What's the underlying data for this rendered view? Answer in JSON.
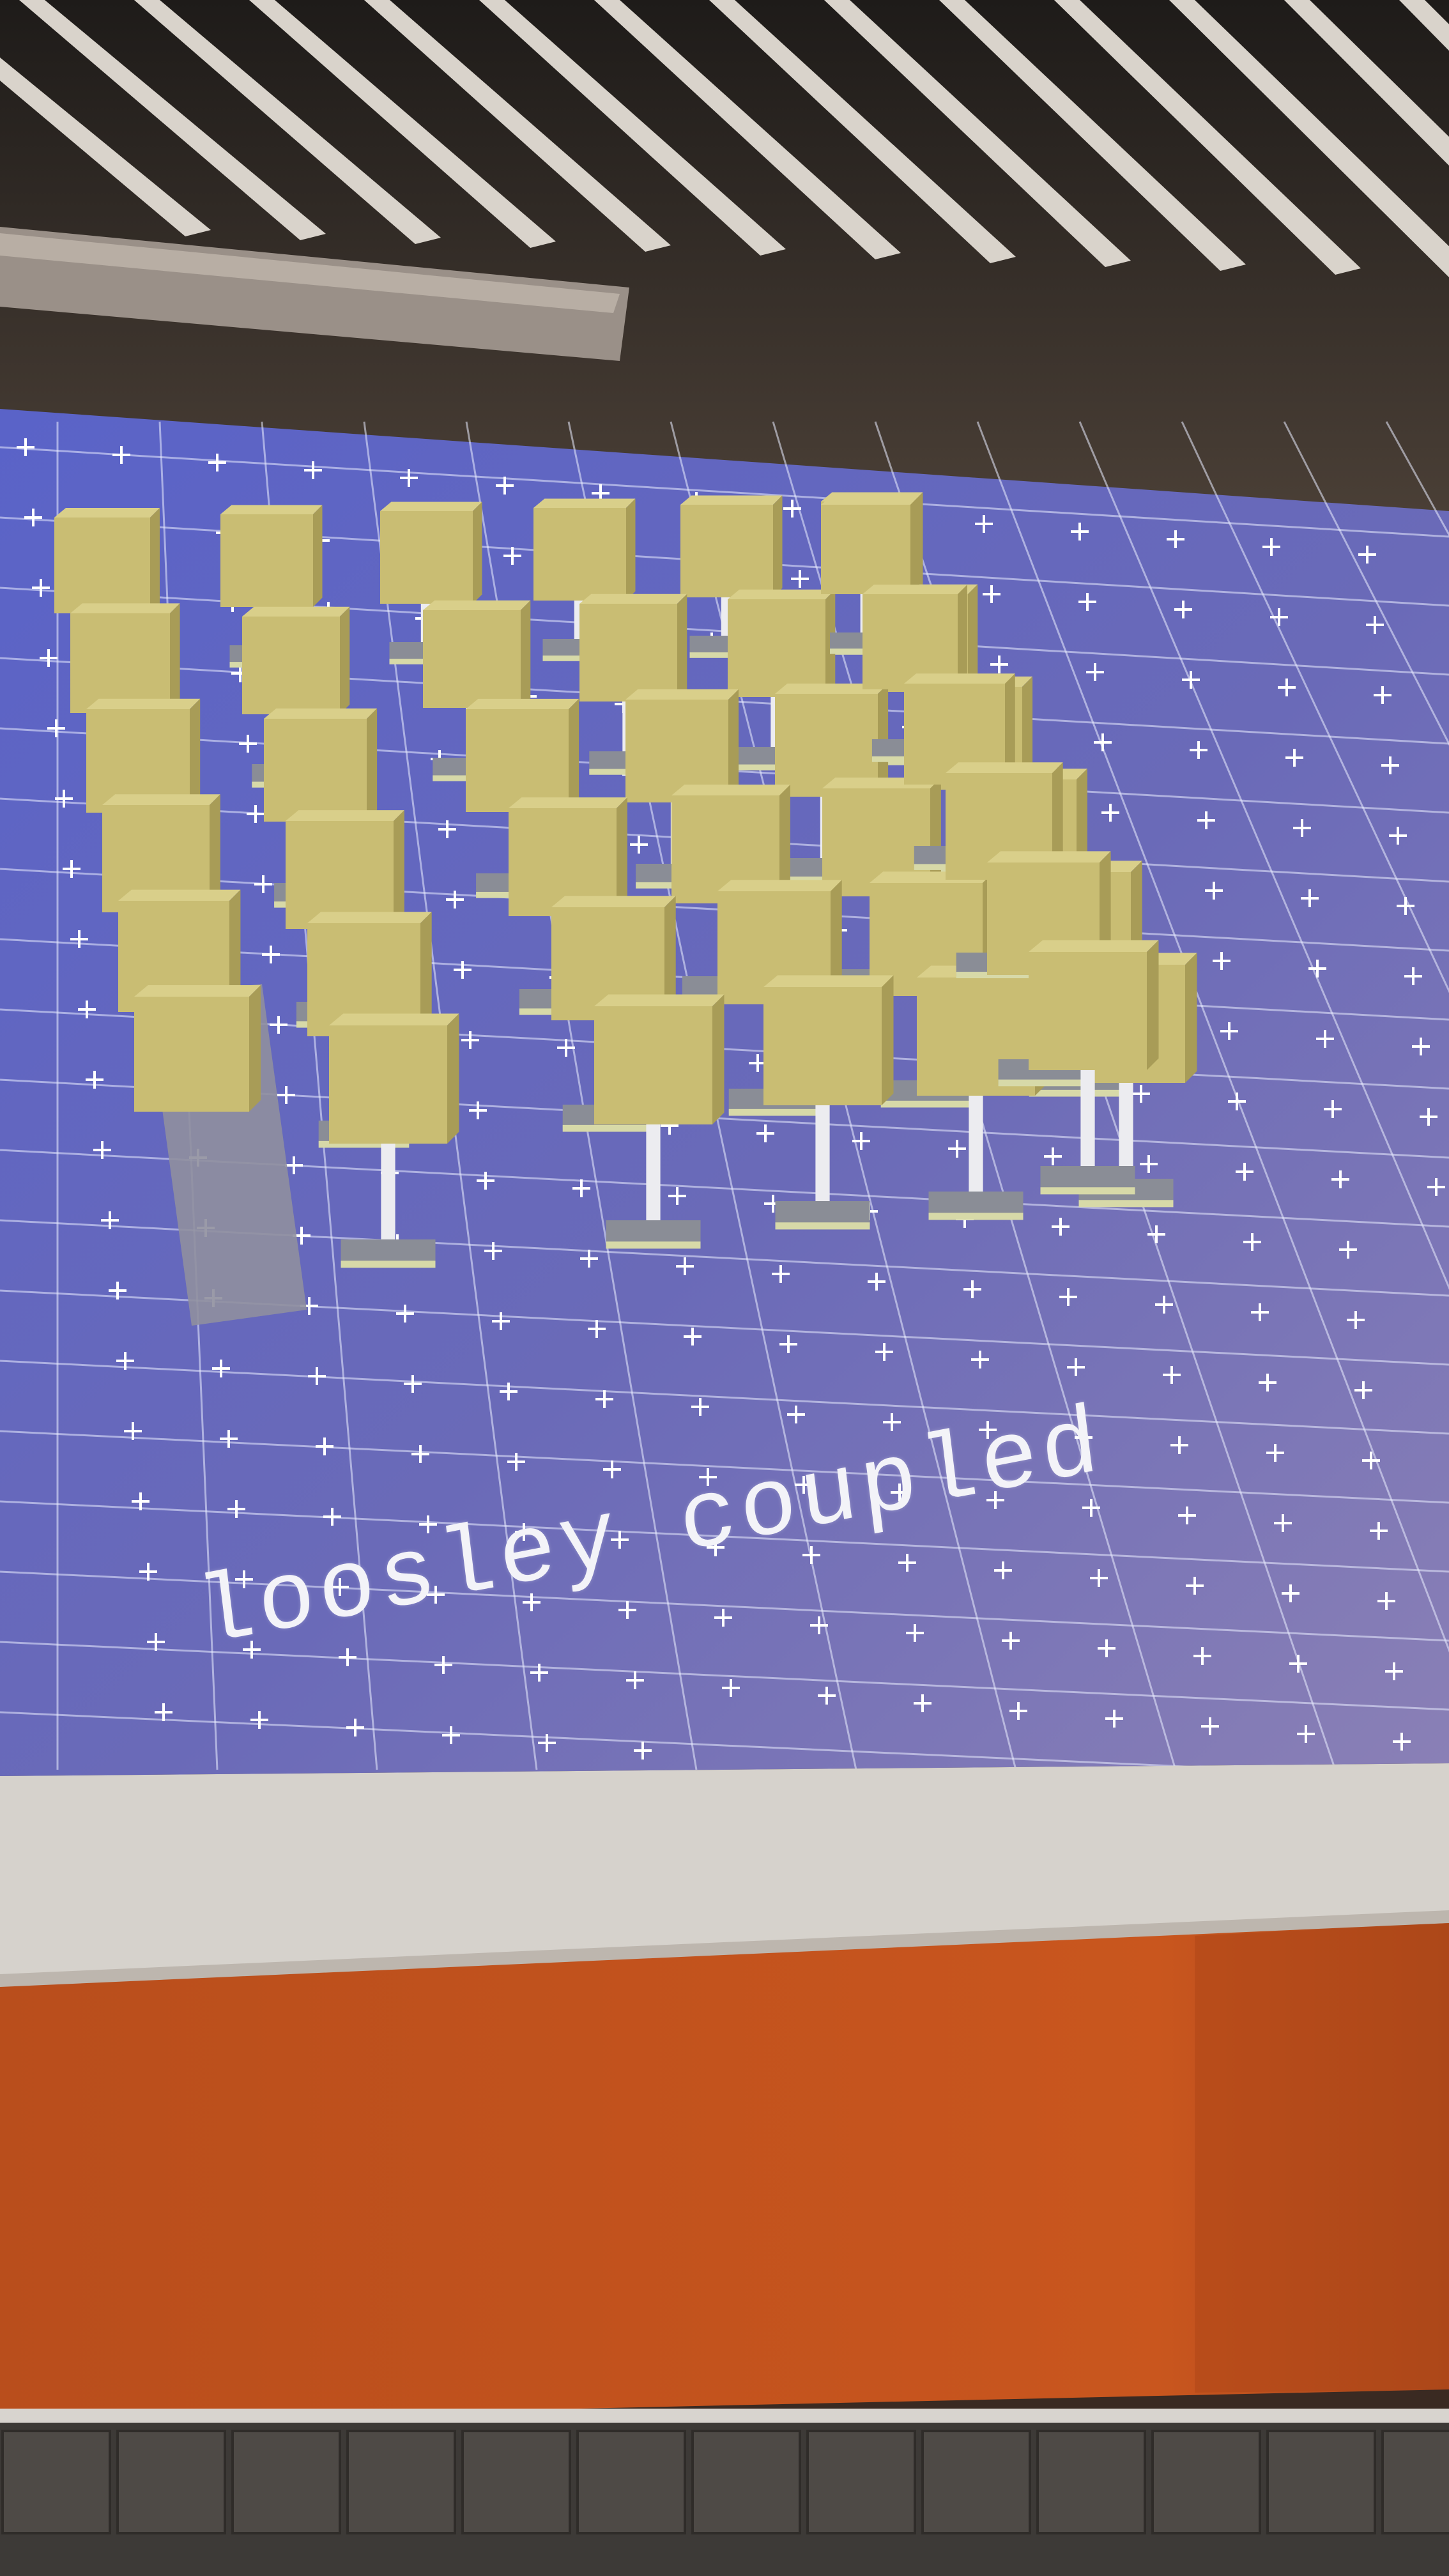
{
  "slide": {
    "caption": "loosley coupled"
  },
  "colors": {
    "screen": "#5f64b8",
    "cube": "#c9bd73",
    "pole": "#e8e8ec",
    "grid": "#e9ecff",
    "wall": "#c4561d",
    "ceiling": "#2a2724"
  },
  "icons": {
    "fixed_block": "gray-slab",
    "module": "cube-on-pole"
  }
}
